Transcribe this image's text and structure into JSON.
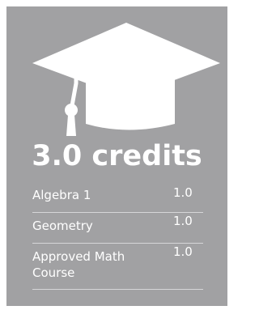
{
  "colors": {
    "card_background": "#a1a1a3",
    "text": "#ffffff",
    "divider": "#d6d6d8"
  },
  "icon": "graduation-cap-icon",
  "summary": {
    "total": "3.0 credits"
  },
  "courses": [
    {
      "name": "Algebra 1",
      "credits": "1.0"
    },
    {
      "name": "Geometry",
      "credits": "1.0"
    },
    {
      "name": "Approved Math Course",
      "credits": "1.0"
    }
  ]
}
